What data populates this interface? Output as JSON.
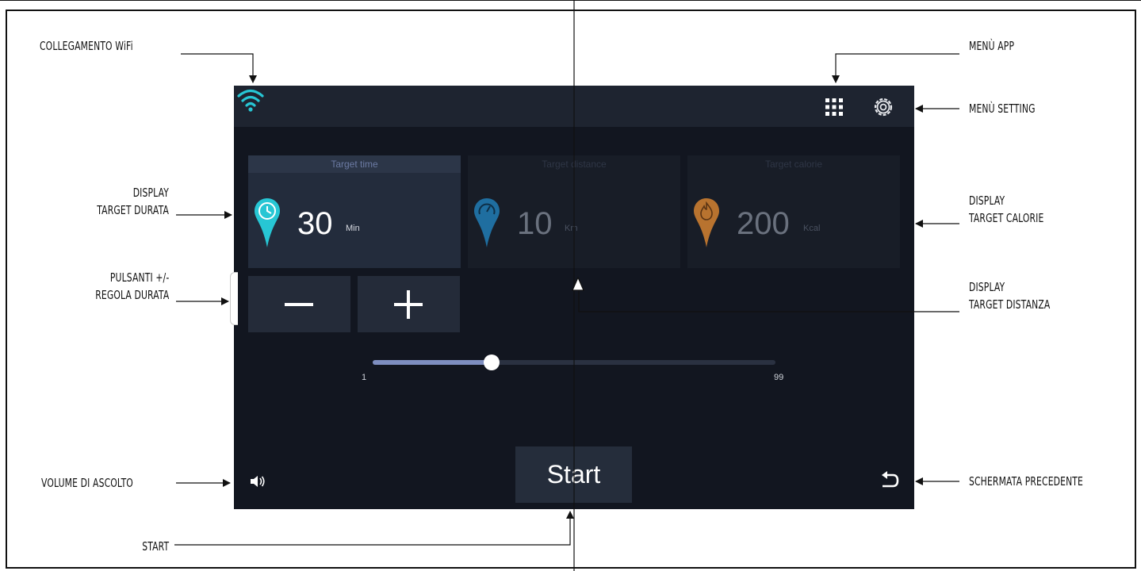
{
  "callouts": {
    "wifi": "COLLEGAMENTO WiFi",
    "menu_app": "MENÙ APP",
    "menu_setting": "MENÙ SETTING",
    "display_durata": [
      "DISPLAY",
      "TARGET DURATA"
    ],
    "display_calorie": [
      "DISPLAY",
      "TARGET CALORIE"
    ],
    "pulsanti": [
      "PULSANTI +/-",
      "REGOLA DURATA"
    ],
    "display_distanza": [
      "DISPLAY",
      "TARGET DISTANZA"
    ],
    "volume": "VOLUME DI ASCOLTO",
    "schermata": "SCHERMATA PRECEDENTE",
    "start": "START"
  },
  "screen": {
    "cards": [
      {
        "title": "Target time",
        "value": "30",
        "unit": "Min",
        "icon": "clock-pin-icon",
        "color": "#27c6d4",
        "active": true
      },
      {
        "title": "Target distance",
        "value": "10",
        "unit": "Km",
        "icon": "gauge-pin-icon",
        "color": "#1f6ea0",
        "active": false
      },
      {
        "title": "Target calorie",
        "value": "200",
        "unit": "Kcal",
        "icon": "flame-pin-icon",
        "color": "#b8732f",
        "active": false
      }
    ],
    "minus_icon": "minus-icon",
    "plus_icon": "plus-icon",
    "slider": {
      "min_label": "1",
      "max_label": "99",
      "min": 1,
      "max": 99,
      "value": 30
    },
    "start_label": "Start"
  },
  "colors": {
    "screen_bg": "#121620",
    "accent": "#27c6d4",
    "slider_fill": "#7e8ec0"
  }
}
